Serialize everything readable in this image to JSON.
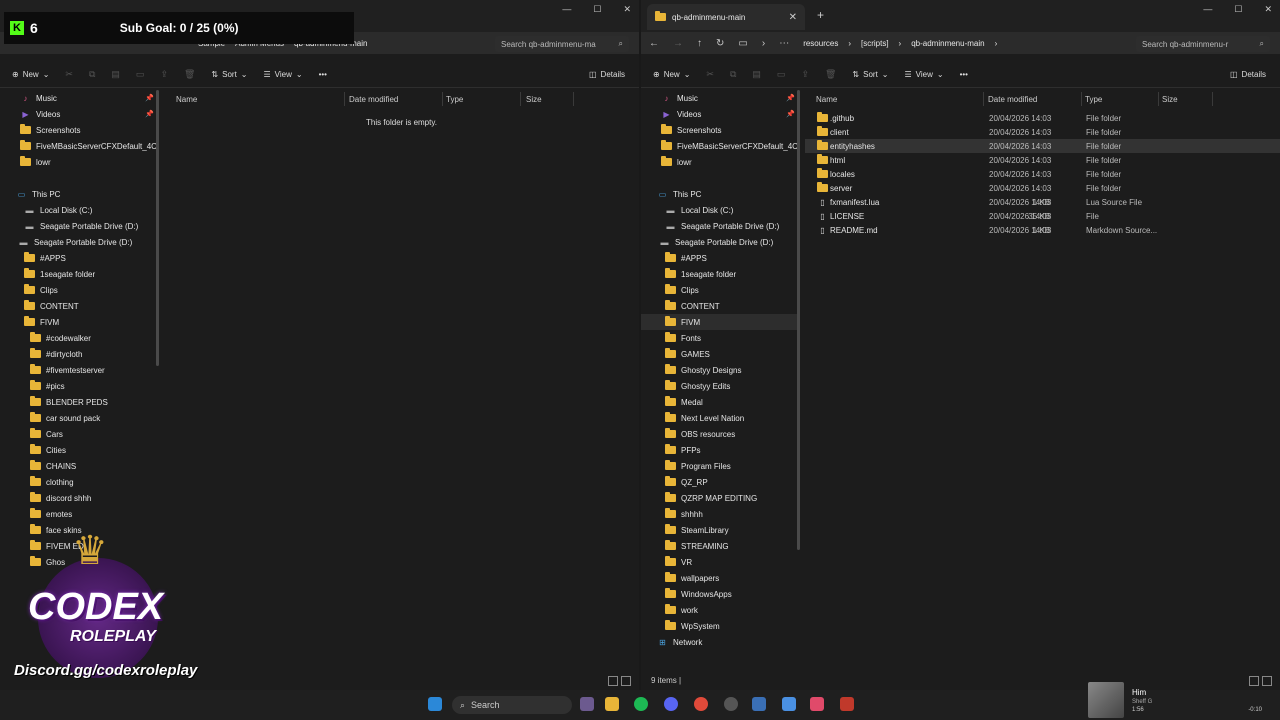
{
  "overlay": {
    "count": "6",
    "goal": "Sub Goal: 0 / 25 (0%)"
  },
  "left": {
    "tab_title": "qb-adminmenu-main",
    "crumbs": [
      "Sample",
      "Admin Menus",
      "qb-adminmenu-main"
    ],
    "search_placeholder": "Search qb-adminmenu-ma",
    "commands": {
      "new": "New",
      "sort": "Sort",
      "view": "View",
      "details": "Details"
    },
    "headers": {
      "name": "Name",
      "date": "Date modified",
      "type": "Type",
      "size": "Size"
    },
    "empty": "This folder is empty.",
    "nav": [
      {
        "label": "Music",
        "icon": "music-icon",
        "pin": true
      },
      {
        "label": "Videos",
        "icon": "videos-icon",
        "pin": true
      },
      {
        "label": "Screenshots",
        "icon": "folder-icon"
      },
      {
        "label": "FiveMBasicServerCFXDefault_4CE",
        "icon": "folder-icon"
      },
      {
        "label": "lowr",
        "icon": "folder-icon"
      },
      {
        "label": "",
        "icon": ""
      },
      {
        "label": "This PC",
        "icon": "pc-icon"
      },
      {
        "label": "Local Disk (C:)",
        "icon": "drive-icon"
      },
      {
        "label": "Seagate Portable Drive (D:)",
        "icon": "drive-icon"
      },
      {
        "label": "Seagate Portable Drive (D:)",
        "icon": "drive-icon"
      },
      {
        "label": "#APPS",
        "icon": "folder-icon"
      },
      {
        "label": "1seagate folder",
        "icon": "folder-icon"
      },
      {
        "label": "Clips",
        "icon": "folder-icon"
      },
      {
        "label": "CONTENT",
        "icon": "folder-icon"
      },
      {
        "label": "FIVM",
        "icon": "folder-icon"
      },
      {
        "label": "#codewalker",
        "icon": "folder-icon"
      },
      {
        "label": "#dirtycloth",
        "icon": "folder-icon"
      },
      {
        "label": "#fivemtestserver",
        "icon": "folder-icon"
      },
      {
        "label": "#pics",
        "icon": "folder-icon"
      },
      {
        "label": "BLENDER PEDS",
        "icon": "folder-icon"
      },
      {
        "label": "car sound pack",
        "icon": "folder-icon"
      },
      {
        "label": "Cars",
        "icon": "folder-icon"
      },
      {
        "label": "Cities",
        "icon": "folder-icon"
      },
      {
        "label": "CHAINS",
        "icon": "folder-icon"
      },
      {
        "label": "clothing",
        "icon": "folder-icon"
      },
      {
        "label": "discord shhh",
        "icon": "folder-icon"
      },
      {
        "label": "emotes",
        "icon": "folder-icon"
      },
      {
        "label": "face skins",
        "icon": "folder-icon"
      },
      {
        "label": "FIVEM EDI",
        "icon": "folder-icon"
      },
      {
        "label": "Ghos",
        "icon": "folder-icon"
      }
    ]
  },
  "right": {
    "tab_title": "qb-adminmenu-main",
    "crumbs": [
      "resources",
      "[scripts]",
      "qb-adminmenu-main"
    ],
    "search_placeholder": "Search qb-adminmenu-r",
    "commands": {
      "new": "New",
      "sort": "Sort",
      "view": "View",
      "details": "Details"
    },
    "headers": {
      "name": "Name",
      "date": "Date modified",
      "type": "Type",
      "size": "Size"
    },
    "files": [
      {
        "name": ".github",
        "date": "20/04/2026 14:03",
        "type": "File folder",
        "size": "",
        "icon": "folder-icon"
      },
      {
        "name": "client",
        "date": "20/04/2026 14:03",
        "type": "File folder",
        "size": "",
        "icon": "folder-icon"
      },
      {
        "name": "entityhashes",
        "date": "20/04/2026 14:03",
        "type": "File folder",
        "size": "",
        "icon": "folder-icon"
      },
      {
        "name": "html",
        "date": "20/04/2026 14:03",
        "type": "File folder",
        "size": "",
        "icon": "folder-icon"
      },
      {
        "name": "locales",
        "date": "20/04/2026 14:03",
        "type": "File folder",
        "size": "",
        "icon": "folder-icon"
      },
      {
        "name": "server",
        "date": "20/04/2026 14:03",
        "type": "File folder",
        "size": "",
        "icon": "folder-icon"
      },
      {
        "name": "fxmanifest.lua",
        "date": "20/04/2026 14:03",
        "type": "Lua Source File",
        "size": "1 KB",
        "icon": "file-icon"
      },
      {
        "name": "LICENSE",
        "date": "20/04/2026 14:03",
        "type": "File",
        "size": "35 KB",
        "icon": "file-icon"
      },
      {
        "name": "README.md",
        "date": "20/04/2026 14:03",
        "type": "Markdown Source...",
        "size": "1 KB",
        "icon": "file-icon"
      }
    ],
    "nav": [
      {
        "label": "Music",
        "icon": "music-icon",
        "pin": true
      },
      {
        "label": "Videos",
        "icon": "videos-icon",
        "pin": true
      },
      {
        "label": "Screenshots",
        "icon": "folder-icon"
      },
      {
        "label": "FiveMBasicServerCFXDefault_4CE",
        "icon": "folder-icon"
      },
      {
        "label": "lowr",
        "icon": "folder-icon"
      },
      {
        "label": "",
        "icon": ""
      },
      {
        "label": "This PC",
        "icon": "pc-icon"
      },
      {
        "label": "Local Disk (C:)",
        "icon": "drive-icon"
      },
      {
        "label": "Seagate Portable Drive (D:)",
        "icon": "drive-icon"
      },
      {
        "label": "Seagate Portable Drive (D:)",
        "icon": "drive-icon"
      },
      {
        "label": "#APPS",
        "icon": "folder-icon"
      },
      {
        "label": "1seagate folder",
        "icon": "folder-icon"
      },
      {
        "label": "Clips",
        "icon": "folder-icon"
      },
      {
        "label": "CONTENT",
        "icon": "folder-icon"
      },
      {
        "label": "FIVM",
        "icon": "folder-icon",
        "selected": true
      },
      {
        "label": "Fonts",
        "icon": "folder-icon"
      },
      {
        "label": "GAMES",
        "icon": "folder-icon"
      },
      {
        "label": "Ghostyy Designs",
        "icon": "folder-icon"
      },
      {
        "label": "Ghostyy Edits",
        "icon": "folder-icon"
      },
      {
        "label": "Medal",
        "icon": "folder-icon"
      },
      {
        "label": "Next Level Nation",
        "icon": "folder-icon"
      },
      {
        "label": "OBS resources",
        "icon": "folder-icon"
      },
      {
        "label": "PFPs",
        "icon": "folder-icon"
      },
      {
        "label": "Program Files",
        "icon": "folder-icon"
      },
      {
        "label": "QZ_RP",
        "icon": "folder-icon"
      },
      {
        "label": "QZRP MAP EDITING",
        "icon": "folder-icon"
      },
      {
        "label": "shhhh",
        "icon": "folder-icon"
      },
      {
        "label": "SteamLibrary",
        "icon": "folder-icon"
      },
      {
        "label": "STREAMING",
        "icon": "folder-icon"
      },
      {
        "label": "VR",
        "icon": "folder-icon"
      },
      {
        "label": "wallpapers",
        "icon": "folder-icon"
      },
      {
        "label": "WindowsApps",
        "icon": "folder-icon"
      },
      {
        "label": "work",
        "icon": "folder-icon"
      },
      {
        "label": "WpSystem",
        "icon": "folder-icon"
      },
      {
        "label": "Network",
        "icon": "network-icon"
      }
    ],
    "status": "9 items"
  },
  "logo": {
    "title": "CODEX",
    "subtitle": "ROLEPLAY",
    "url": "Discord.gg/codexroleplay"
  },
  "taskbar": {
    "search": "Search"
  },
  "media": {
    "title": "Him",
    "artist": "Sheff G",
    "elapsed": "1:56",
    "remaining": "-0:10"
  }
}
